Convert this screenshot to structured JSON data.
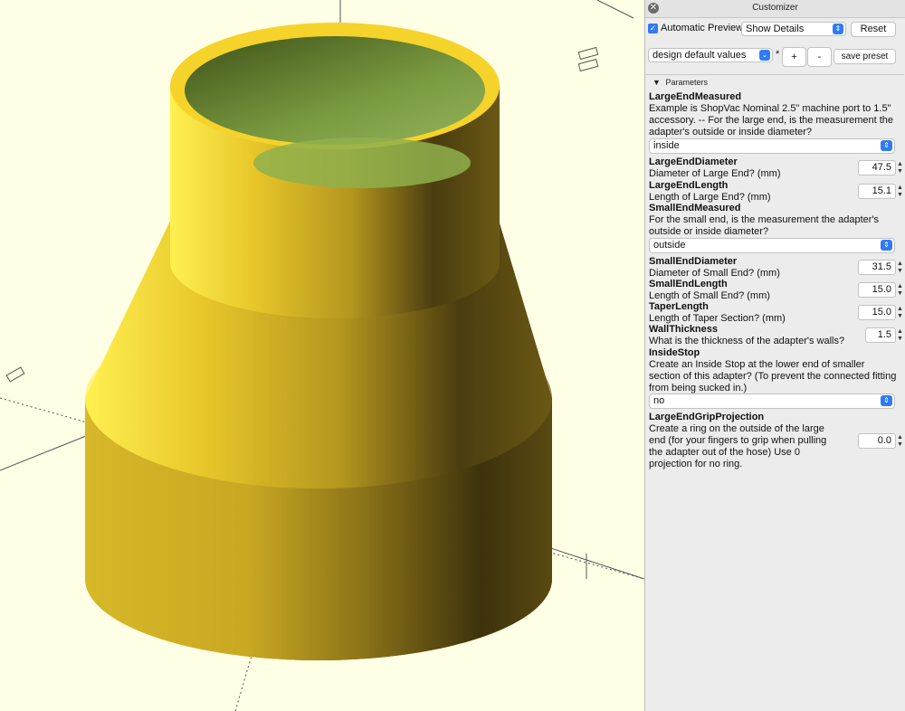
{
  "window": {
    "title": "Customizer"
  },
  "toolbar": {
    "auto_preview_label": "Automatic Preview",
    "details_value": "Show Details",
    "reset_label": "Reset",
    "preset_value": "design default values",
    "preset_marker": "*",
    "add_preset_label": "+",
    "remove_preset_label": "-",
    "save_preset_label": "save preset"
  },
  "parameters": {
    "section_label": "Parameters",
    "large_end_measured": {
      "name": "LargeEndMeasured",
      "desc": "Example is ShopVac Nominal 2.5\" machine port to 1.5\" accessory.  -- For the large end, is the measurement the adapter's outside or inside diameter?",
      "value": "inside"
    },
    "large_end_diameter": {
      "name": "LargeEndDiameter",
      "desc": "Diameter of Large End? (mm)",
      "value": "47.5"
    },
    "large_end_length": {
      "name": "LargeEndLength",
      "desc": "Length of Large End? (mm)",
      "value": "15.1"
    },
    "small_end_measured": {
      "name": "SmallEndMeasured",
      "desc": "For the small end, is the measurement the adapter's outside or inside diameter?",
      "value": "outside"
    },
    "small_end_diameter": {
      "name": "SmallEndDiameter",
      "desc": "Diameter of Small End? (mm)",
      "value": "31.5"
    },
    "small_end_length": {
      "name": "SmallEndLength",
      "desc": "Length of Small End? (mm)",
      "value": "15.0"
    },
    "taper_length": {
      "name": "TaperLength",
      "desc": "Length of Taper Section? (mm)",
      "value": "15.0"
    },
    "wall_thickness": {
      "name": "WallThickness",
      "desc": "What is the thickness of the adapter's walls?",
      "value": "1.5"
    },
    "inside_stop": {
      "name": "InsideStop",
      "desc": "Create an Inside Stop at the lower end of smaller section of this adapter? (To prevent the connected fitting from being sucked in.)",
      "value": "no"
    },
    "grip_projection": {
      "name": "LargeEndGripProjection",
      "desc": "Create a ring on the outside of the large end (for your fingers to grip when pulling the adapter out of the hose)  Use 0 projection for no ring.",
      "value": "0.0"
    }
  },
  "colors": {
    "model": "#f2cf2b",
    "background": "#ffffe5",
    "accent": "#2f7bf6",
    "interior": "#7e9e46"
  }
}
